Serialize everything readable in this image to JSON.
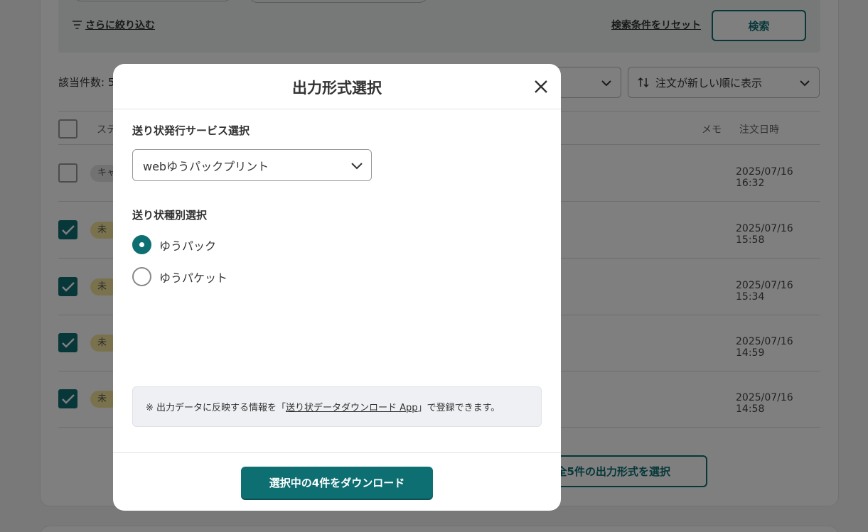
{
  "background": {
    "filter_more_label": "さらに絞り込む",
    "reset_label": "検索条件をリセット",
    "search_label": "検索",
    "result_count_label": "該当件数: 5",
    "sort_label": "注文が新しい順に表示",
    "table_headers": {
      "status": "ステ",
      "memo": "メモ",
      "order_date": "注文日時"
    },
    "rows": [
      {
        "status": "キャ",
        "checked": false,
        "date": "2025/07/16 16:32"
      },
      {
        "status": "未",
        "checked": true,
        "date": "2025/07/16 15:58"
      },
      {
        "status": "未",
        "checked": true,
        "date": "2025/07/16 15:34"
      },
      {
        "status": "未",
        "checked": true,
        "date": "2025/07/16 14:59"
      },
      {
        "status": "未",
        "checked": true,
        "date": "2025/07/16 14:58"
      }
    ],
    "bottom_button_label": "全5件の出力形式を選択"
  },
  "modal": {
    "title": "出力形式選択",
    "service_label": "送り状発行サービス選択",
    "service_selected": "webゆうパックプリント",
    "type_label": "送り状種別選択",
    "options": [
      {
        "label": "ゆうパック",
        "selected": true
      },
      {
        "label": "ゆうパケット",
        "selected": false
      }
    ],
    "note_prefix": "※ 出力データに反映する情報を「",
    "note_link": "送り状データダウンロード App",
    "note_suffix": "」で登録できます。",
    "download_label": "選択中の4件をダウンロード"
  },
  "colors": {
    "accent": "#0e6f73",
    "overlay": "rgba(0,0,0,0.5)"
  }
}
